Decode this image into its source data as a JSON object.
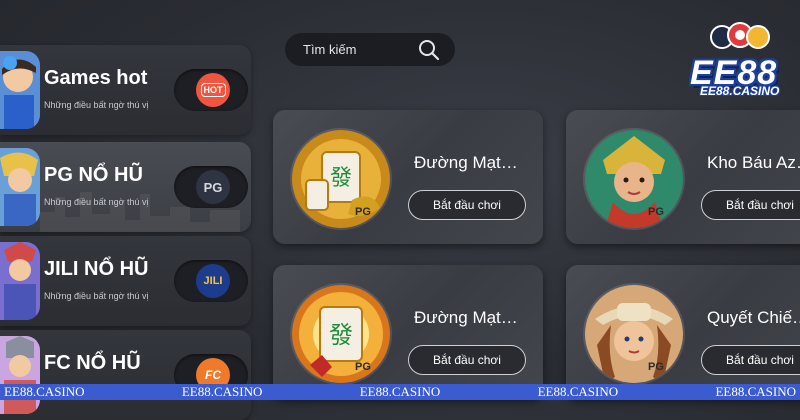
{
  "sidebar": {
    "items": [
      {
        "title": "Games hot",
        "subtitle": "Những điều bất ngờ thú vị",
        "badge": "HOT",
        "badge_color": "#f0563f",
        "active": false
      },
      {
        "title": "PG NỔ HŨ",
        "subtitle": "Những điều bất ngờ thú vị",
        "badge": "PG",
        "badge_color": "#2f3442",
        "active": true
      },
      {
        "title": "JILI NỔ HŨ",
        "subtitle": "Những điều bất ngờ thú vị",
        "badge": "JILI",
        "badge_color": "#1e3c8c",
        "active": false
      },
      {
        "title": "FC NỔ HŨ",
        "subtitle": "",
        "badge": "FC",
        "badge_color": "#f07a2a",
        "active": false
      }
    ]
  },
  "search": {
    "placeholder": "Tìm kiếm",
    "icon": "search-icon"
  },
  "logo": {
    "word": "EE88",
    "domain": "EE88.CASINO"
  },
  "games": [
    {
      "name": "Đường Mạt…",
      "button": "Bắt đầu chơi",
      "provider": "PG",
      "thumb_theme": "mahjong-gold"
    },
    {
      "name": "Kho Báu Az…",
      "button": "Bắt đầu chơi",
      "provider": "PG",
      "thumb_theme": "aztec-woman"
    },
    {
      "name": "Đường Mạt…",
      "button": "Bắt đầu chơi",
      "provider": "PG",
      "thumb_theme": "mahjong-fire"
    },
    {
      "name": "Quyết Chiế…",
      "button": "Bắt đầu chơi",
      "provider": "PG",
      "thumb_theme": "cowgirl"
    }
  ],
  "watermark": [
    "EE88.CASINO",
    "EE88.CASINO",
    "EE88.CASINO",
    "EE88.CASINO",
    "EE88.CASINO"
  ],
  "colors": {
    "accent": "#3b5bd1",
    "background": "#2a2c33"
  }
}
